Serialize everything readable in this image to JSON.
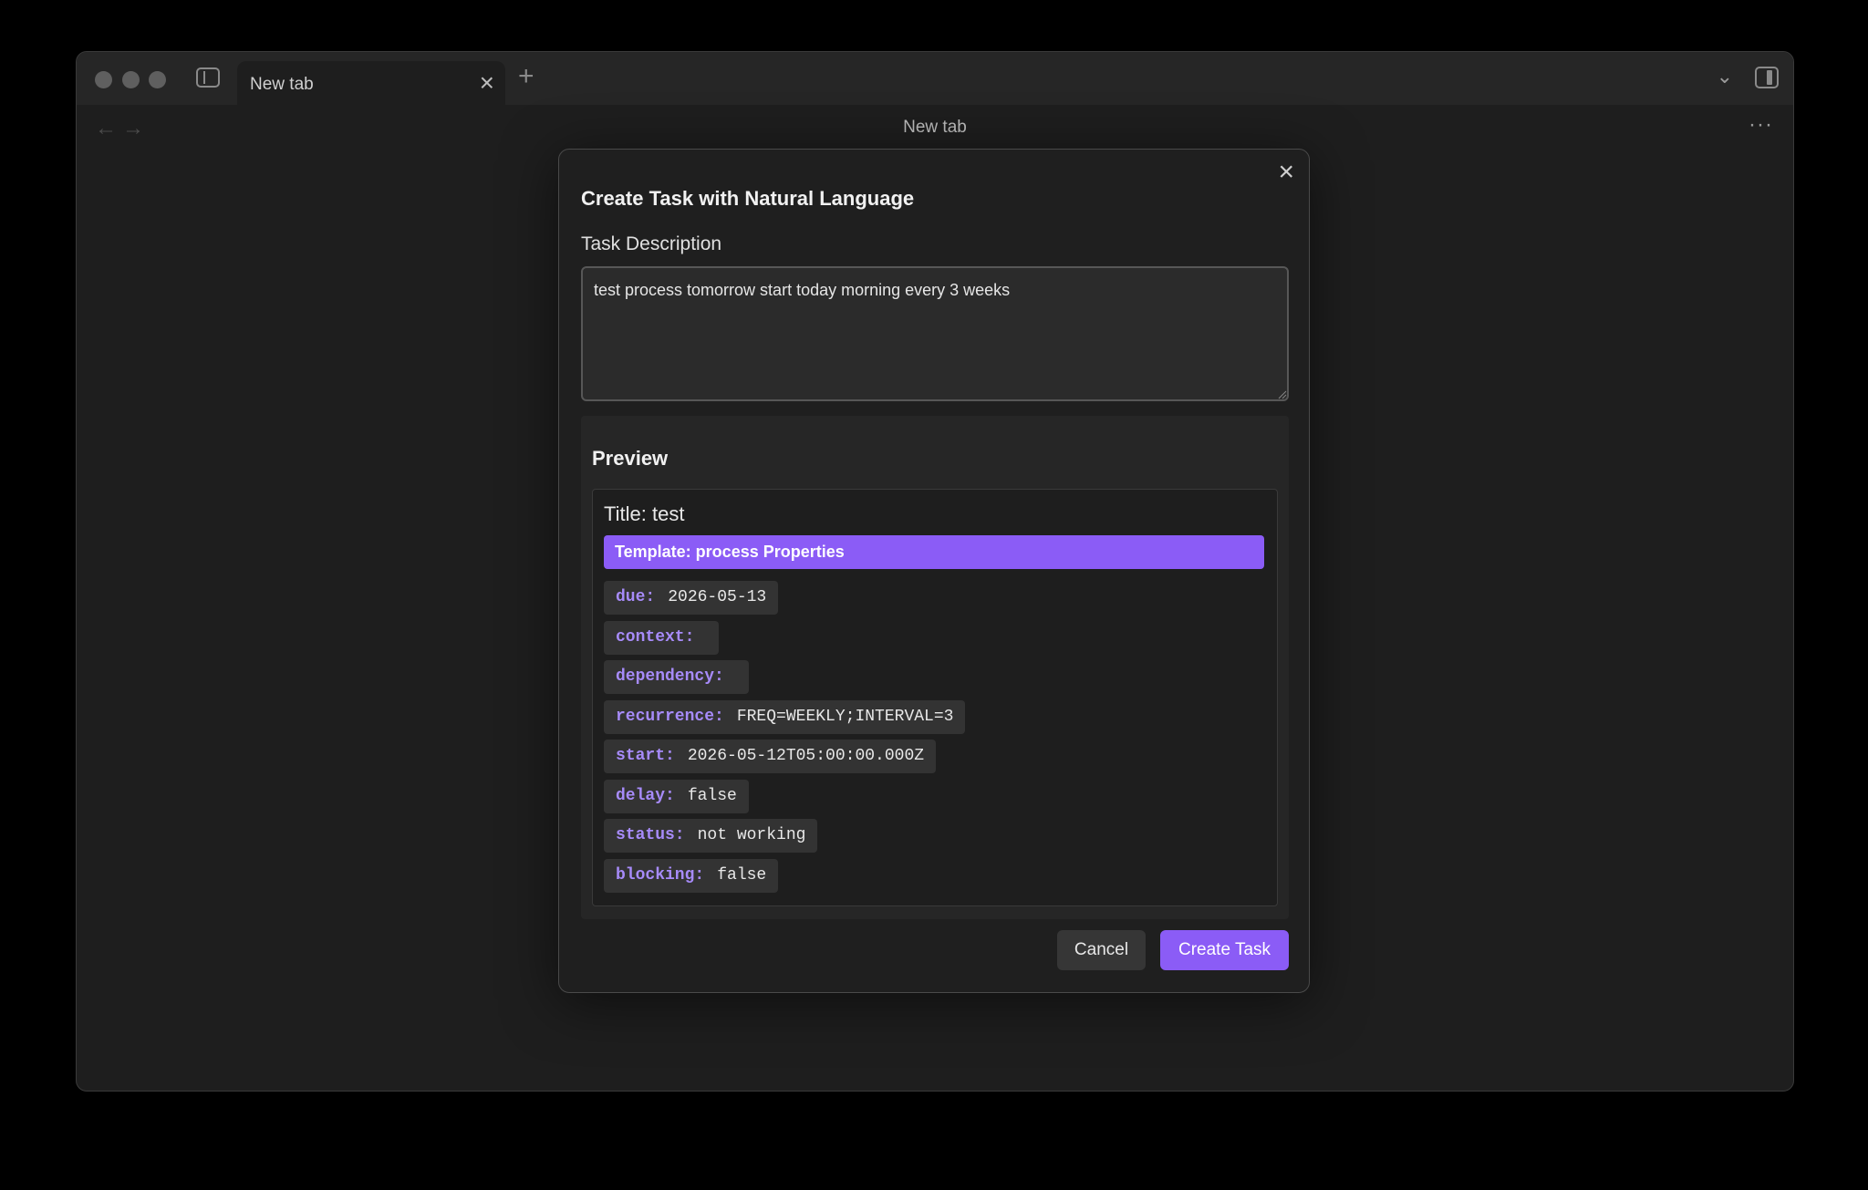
{
  "window": {
    "tab_label": "New tab",
    "view_title": "New tab"
  },
  "modal": {
    "title": "Create Task with Natural Language",
    "field_label": "Task Description",
    "textarea_value": "test process tomorrow start today morning every 3 weeks",
    "preview_heading": "Preview",
    "preview_title": "Title: test",
    "template": "Template: process Properties",
    "properties": [
      {
        "key": "due:",
        "value": "2026-05-13"
      },
      {
        "key": "context:",
        "value": ""
      },
      {
        "key": "dependency:",
        "value": ""
      },
      {
        "key": "recurrence:",
        "value": "FREQ=WEEKLY;INTERVAL=3"
      },
      {
        "key": "start:",
        "value": "2026-05-12T05:00:00.000Z"
      },
      {
        "key": "delay:",
        "value": "false"
      },
      {
        "key": "status:",
        "value": "not working"
      },
      {
        "key": "blocking:",
        "value": "false"
      }
    ],
    "cancel_label": "Cancel",
    "create_label": "Create Task"
  },
  "icons": {
    "close": "close-icon",
    "plus": "plus-icon",
    "back": "arrow-left-icon",
    "forward": "arrow-right-icon",
    "more": "more-horizontal-icon"
  },
  "colors": {
    "accent": "#8b5cf6",
    "property_key": "#a78bfa"
  }
}
